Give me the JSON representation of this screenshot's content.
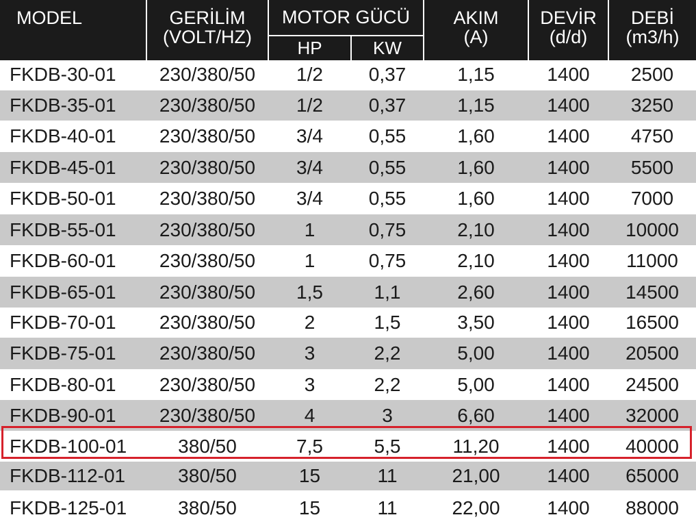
{
  "table": {
    "headers": {
      "model": "MODEL",
      "voltage": [
        "GERİLİM",
        "(VOLT/HZ)"
      ],
      "motor_power": "MOTOR GÜCÜ",
      "hp": "HP",
      "kw": "KW",
      "current": [
        "AKIM",
        "(A)"
      ],
      "rpm": [
        "DEVİR",
        "(d/d)"
      ],
      "flow": [
        "DEBİ",
        "(m3/h)"
      ]
    },
    "rows": [
      [
        "FKDB-30-01",
        "230/380/50",
        "1/2",
        "0,37",
        "1,15",
        "1400",
        "2500"
      ],
      [
        "FKDB-35-01",
        "230/380/50",
        "1/2",
        "0,37",
        "1,15",
        "1400",
        "3250"
      ],
      [
        "FKDB-40-01",
        "230/380/50",
        "3/4",
        "0,55",
        "1,60",
        "1400",
        "4750"
      ],
      [
        "FKDB-45-01",
        "230/380/50",
        "3/4",
        "0,55",
        "1,60",
        "1400",
        "5500"
      ],
      [
        "FKDB-50-01",
        "230/380/50",
        "3/4",
        "0,55",
        "1,60",
        "1400",
        "7000"
      ],
      [
        "FKDB-55-01",
        "230/380/50",
        "1",
        "0,75",
        "2,10",
        "1400",
        "10000"
      ],
      [
        "FKDB-60-01",
        "230/380/50",
        "1",
        "0,75",
        "2,10",
        "1400",
        "11000"
      ],
      [
        "FKDB-65-01",
        "230/380/50",
        "1,5",
        "1,1",
        "2,60",
        "1400",
        "14500"
      ],
      [
        "FKDB-70-01",
        "230/380/50",
        "2",
        "1,5",
        "3,50",
        "1400",
        "16500"
      ],
      [
        "FKDB-75-01",
        "230/380/50",
        "3",
        "2,2",
        "5,00",
        "1400",
        "20500"
      ],
      [
        "FKDB-80-01",
        "230/380/50",
        "3",
        "2,2",
        "5,00",
        "1400",
        "24500"
      ],
      [
        "FKDB-90-01",
        "230/380/50",
        "4",
        "3",
        "6,60",
        "1400",
        "32000"
      ],
      [
        "FKDB-100-01",
        "380/50",
        "7,5",
        "5,5",
        "11,20",
        "1400",
        "40000"
      ],
      [
        "FKDB-112-01",
        "380/50",
        "15",
        "11",
        "21,00",
        "1400",
        "65000"
      ],
      [
        "FKDB-125-01",
        "380/50",
        "15",
        "11",
        "22,00",
        "1400",
        "88000"
      ]
    ],
    "highlighted_row": 12,
    "colors": {
      "header_bg": "#1b1b1b",
      "header_text": "#ffffff",
      "alt_row_bg": "#c9c9c9",
      "highlight_border": "#d6212b"
    }
  }
}
